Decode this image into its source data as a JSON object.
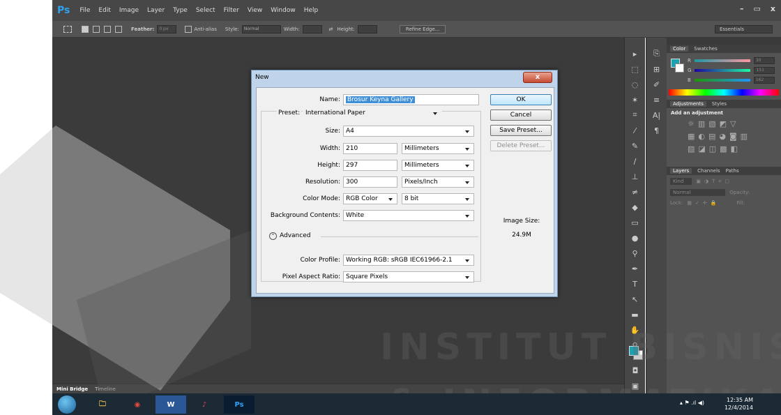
{
  "menubar": {
    "logo": "Ps",
    "items": [
      "File",
      "Edit",
      "Image",
      "Layer",
      "Type",
      "Select",
      "Filter",
      "View",
      "Window",
      "Help"
    ],
    "window_controls": [
      "–",
      "▭",
      "x"
    ]
  },
  "options": {
    "feather_label": "Feather:",
    "feather_value": "0 px",
    "antialias_label": "Anti-alias",
    "style_label": "Style:",
    "style_value": "Normal",
    "width_label": "Width:",
    "height_label": "Height:",
    "refine_edge": "Refine Edge...",
    "workspace": "Essentials"
  },
  "bottom_tabs": [
    "Mini Bridge",
    "Timeline"
  ],
  "panels": {
    "color_tabs": [
      "Color",
      "Swatches"
    ],
    "rgb": [
      {
        "label": "R",
        "value": "30"
      },
      {
        "label": "G",
        "value": "151"
      },
      {
        "label": "B",
        "value": "162"
      }
    ],
    "adj_tabs": [
      "Adjustments",
      "Styles"
    ],
    "add_adjustment": "Add an adjustment",
    "layers_tabs": [
      "Layers",
      "Channels",
      "Paths"
    ],
    "kind": "Kind",
    "blend_mode": "Normal",
    "opacity_label": "Opacity:",
    "lock_label": "Lock:",
    "fill_label": "Fill:"
  },
  "dialog": {
    "title": "New",
    "close_glyph": "x",
    "name_label": "Name:",
    "name_value": "Brosur Keyna Gallery",
    "preset_label": "Preset:",
    "preset_value": "International Paper",
    "size_label": "Size:",
    "size_value": "A4",
    "width_label": "Width:",
    "width_value": "210",
    "width_unit": "Millimeters",
    "height_label": "Height:",
    "height_value": "297",
    "height_unit": "Millimeters",
    "resolution_label": "Resolution:",
    "resolution_value": "300",
    "resolution_unit": "Pixels/Inch",
    "color_mode_label": "Color Mode:",
    "color_mode_value": "RGB Color",
    "bit_depth_value": "8 bit",
    "bg_label": "Background Contents:",
    "bg_value": "White",
    "advanced_label": "Advanced",
    "color_profile_label": "Color Profile:",
    "color_profile_value": "Working RGB:  sRGB IEC61966-2.1",
    "pixel_aspect_label": "Pixel Aspect Ratio:",
    "pixel_aspect_value": "Square Pixels",
    "buttons": {
      "ok": "OK",
      "cancel": "Cancel",
      "save_preset": "Save Preset...",
      "delete_preset": "Delete Preset..."
    },
    "image_size_label": "Image Size:",
    "image_size_value": "24.9M"
  },
  "taskbar": {
    "apps": [
      {
        "name": "explorer-icon",
        "glyph": "🗀"
      },
      {
        "name": "chrome-icon",
        "glyph": "◉"
      },
      {
        "name": "word-icon",
        "glyph": "W"
      },
      {
        "name": "itunes-icon",
        "glyph": "♪"
      },
      {
        "name": "photoshop-icon",
        "glyph": "Ps"
      }
    ],
    "time": "12:35 AM",
    "date": "12/4/2014"
  },
  "watermark": {
    "line1": "INSTITUT BISNIS",
    "line2": "& INFORMATIKA"
  },
  "colors": {
    "accent": "#1aa3b3",
    "ps_blue": "#2fa3f0"
  }
}
